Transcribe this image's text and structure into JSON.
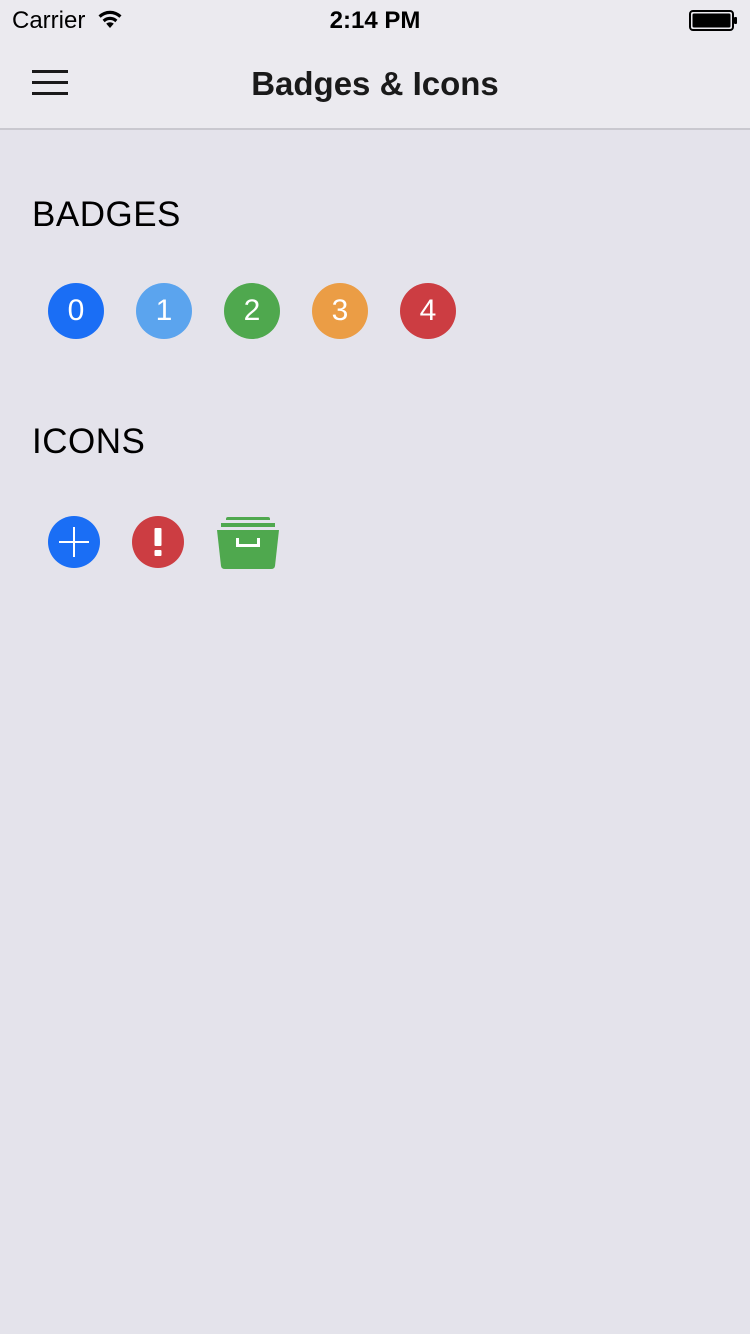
{
  "status_bar": {
    "carrier": "Carrier",
    "time": "2:14 PM"
  },
  "nav": {
    "title": "Badges & Icons",
    "menu_icon": "hamburger-menu-icon"
  },
  "sections": {
    "badges_title": "BADGES",
    "icons_title": "ICONS"
  },
  "badges": [
    {
      "label": "0",
      "color": "#1a6ef5"
    },
    {
      "label": "1",
      "color": "#5ba4ee"
    },
    {
      "label": "2",
      "color": "#4fa84e"
    },
    {
      "label": "3",
      "color": "#eb9d45"
    },
    {
      "label": "4",
      "color": "#cc3d42"
    }
  ],
  "icons": [
    {
      "name": "add-icon",
      "color": "#1a6ef5"
    },
    {
      "name": "alert-icon",
      "color": "#cc3d42"
    },
    {
      "name": "archive-icon",
      "color": "#4fa84e"
    }
  ]
}
